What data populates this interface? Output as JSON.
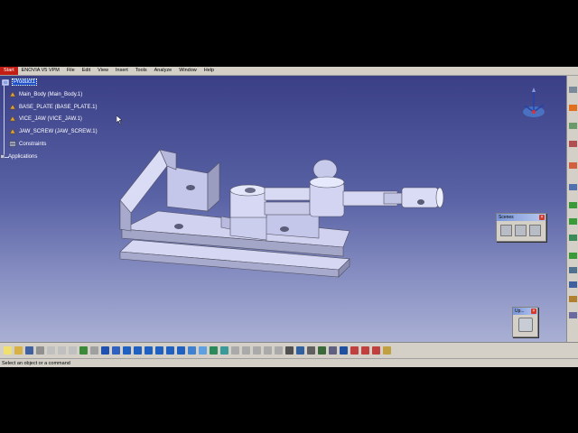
{
  "menu": {
    "items": [
      "Start",
      "ENOVIA V5 VPM",
      "File",
      "Edit",
      "View",
      "Insert",
      "Tools",
      "Analyze",
      "Window",
      "Help"
    ]
  },
  "tree": {
    "root": "Product1",
    "children": [
      "Main_Body (Main_Body.1)",
      "BASE_PLATE (BASE_PLATE.1)",
      "VICE_JAW (VICE_JAW.1)",
      "JAW_SCREW (JAW_SCREW.1)",
      "Constraints"
    ],
    "applications": "Applications"
  },
  "scenes_panel": {
    "title": "Scenes"
  },
  "update_panel": {
    "title": "Up..."
  },
  "status": {
    "message": "Select an object or a command"
  },
  "colors": {
    "start_menu": "#c21e14",
    "viewport_top": "#3a3f86",
    "viewport_bottom": "#aeb4d6",
    "part_fill": "#c9cbef"
  },
  "icons": [
    "compass-icon",
    "product-icon",
    "part-icon",
    "constraints-icon",
    "applications-icon"
  ]
}
